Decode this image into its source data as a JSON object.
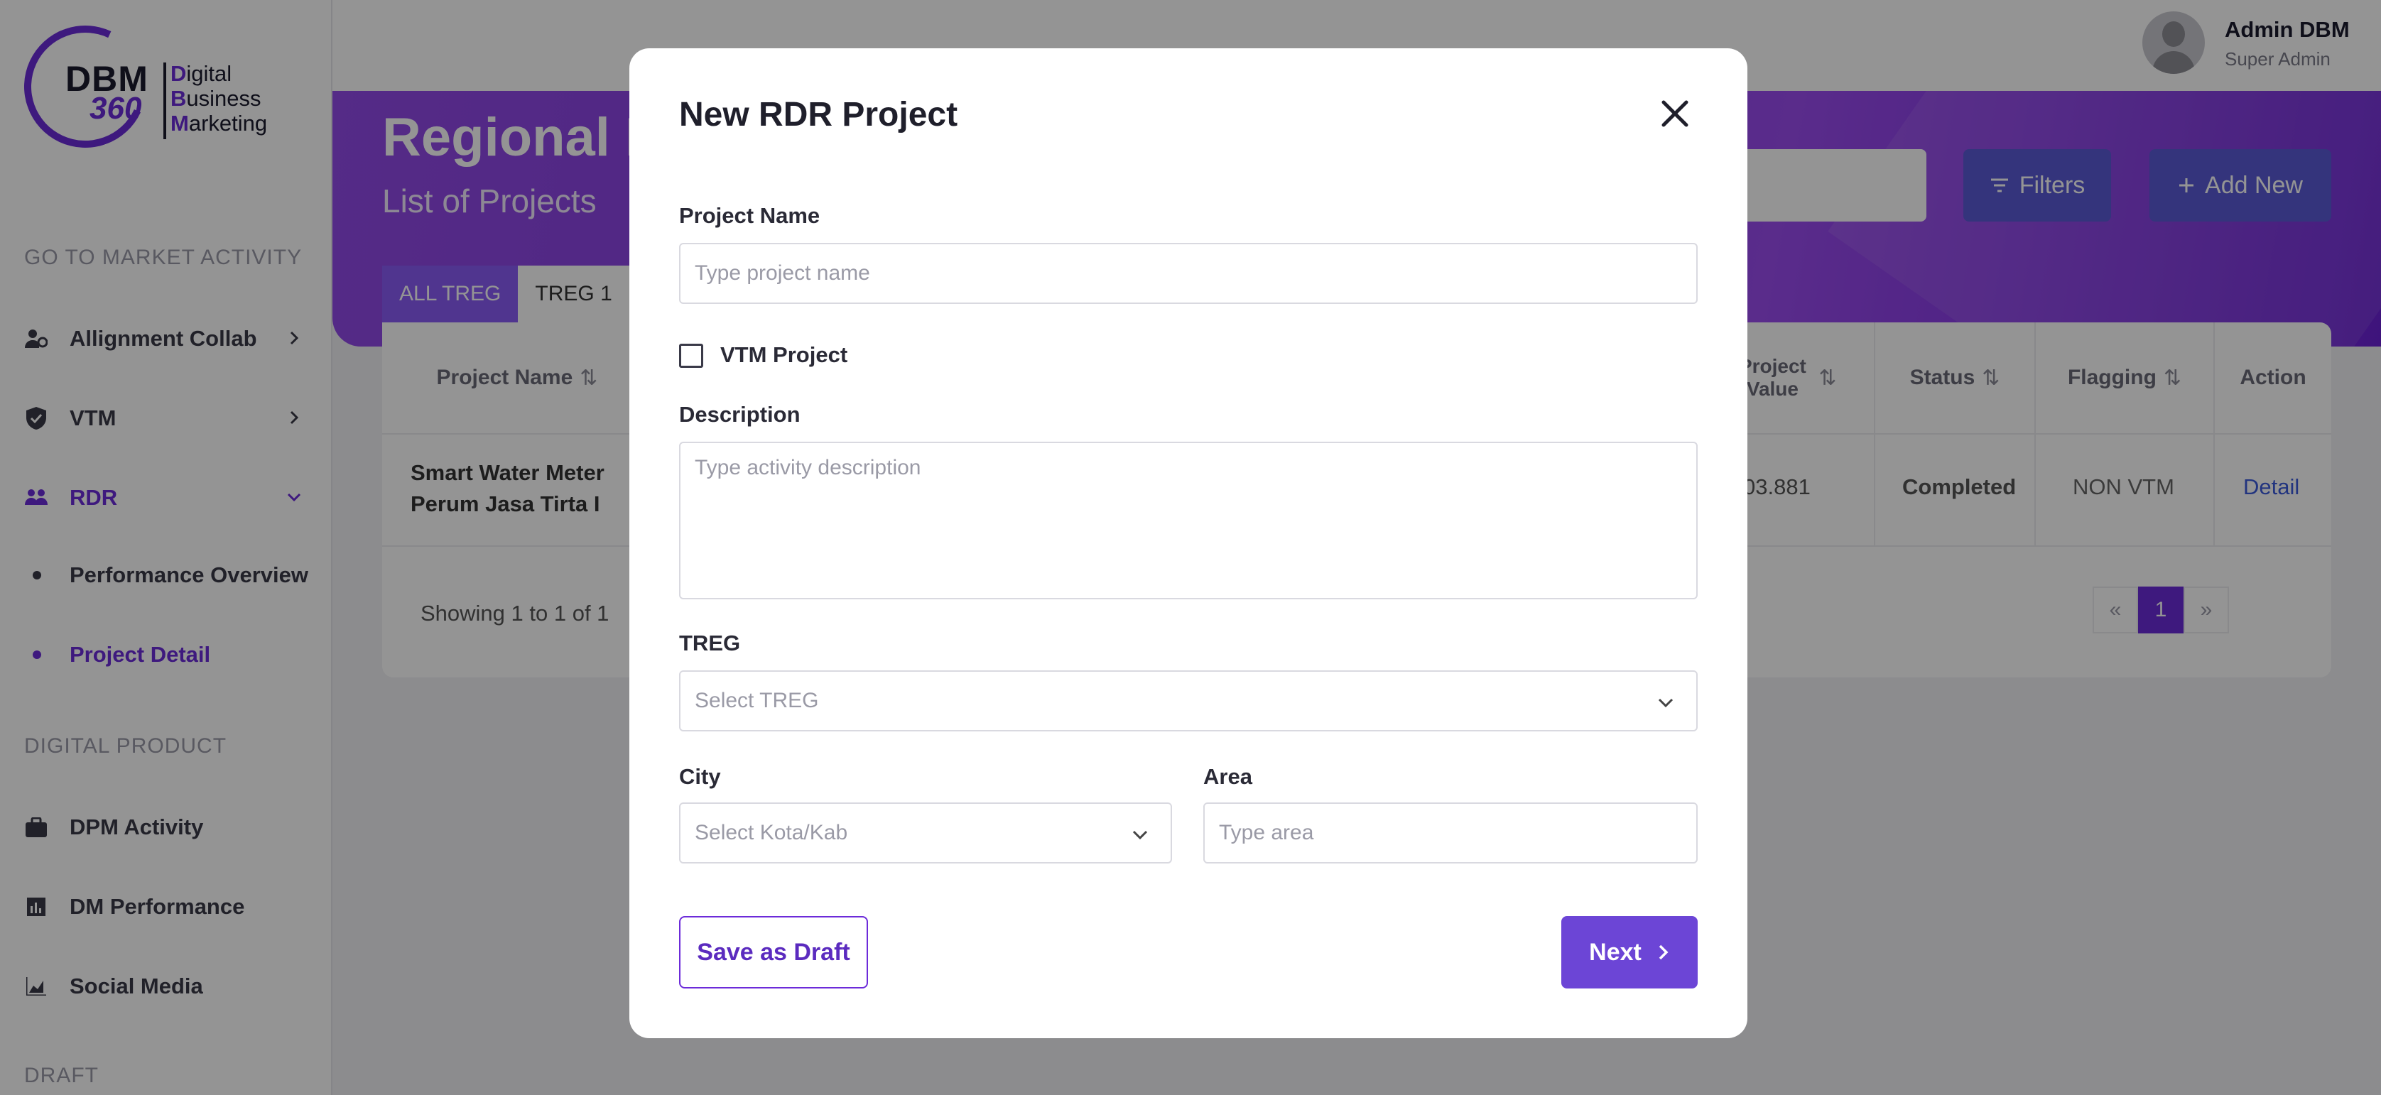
{
  "brand": {
    "logo_short": "DBM",
    "logo_number": "360",
    "logo_words": [
      "Digital",
      "Business",
      "Marketing"
    ]
  },
  "sidebar": {
    "sections": [
      {
        "label": "GO TO MARKET ACTIVITY"
      },
      {
        "label": "DIGITAL PRODUCT"
      },
      {
        "label": "DRAFT"
      }
    ],
    "items": [
      {
        "label": "Allignment Collab",
        "icon": "users-gear-icon"
      },
      {
        "label": "VTM",
        "icon": "shield-check-icon"
      },
      {
        "label": "RDR",
        "icon": "people-group-icon",
        "expanded": true
      },
      {
        "label": "DPM Activity",
        "icon": "briefcase-icon"
      },
      {
        "label": "DM Performance",
        "icon": "bar-chart-icon"
      },
      {
        "label": "Social Media",
        "icon": "area-chart-icon"
      }
    ],
    "sub_items": [
      {
        "label": "Performance Overview"
      },
      {
        "label": "Project Detail",
        "active": true
      }
    ]
  },
  "topbar": {
    "user_name": "Admin DBM",
    "user_role": "Super Admin"
  },
  "page": {
    "title": "Regional Development",
    "subtitle": "List of Projects",
    "filters_label": "Filters",
    "add_new_label": "Add New",
    "tabs": [
      "ALL TREG",
      "TREG 1"
    ]
  },
  "table": {
    "headers": {
      "project_name": "Project Name",
      "project_value": "Project Value",
      "status": "Status",
      "flagging": "Flagging",
      "action": "Action"
    },
    "rows": [
      {
        "project_name": "Smart Water Meter Perum Jasa Tirta I",
        "project_value": "03.881",
        "status": "Completed",
        "flagging": "NON VTM",
        "action": "Detail"
      }
    ],
    "showing": "Showing 1 to 1 of 1",
    "pagination": {
      "prev": "«",
      "current": "1",
      "next": "»"
    }
  },
  "modal": {
    "title": "New RDR Project",
    "project_name_label": "Project Name",
    "project_name_placeholder": "Type project name",
    "vtm_label": "VTM Project",
    "vtm_checked": false,
    "description_label": "Description",
    "description_placeholder": "Type activity description",
    "treg_label": "TREG",
    "treg_placeholder": "Select TREG",
    "city_label": "City",
    "city_placeholder": "Select Kota/Kab",
    "area_label": "Area",
    "area_placeholder": "Type area",
    "save_draft_label": "Save as Draft",
    "next_label": "Next"
  },
  "colors": {
    "accent": "#6c2bd9",
    "button_primary": "#6c45d6",
    "overlay": "rgba(0,0,0,0.42)"
  }
}
